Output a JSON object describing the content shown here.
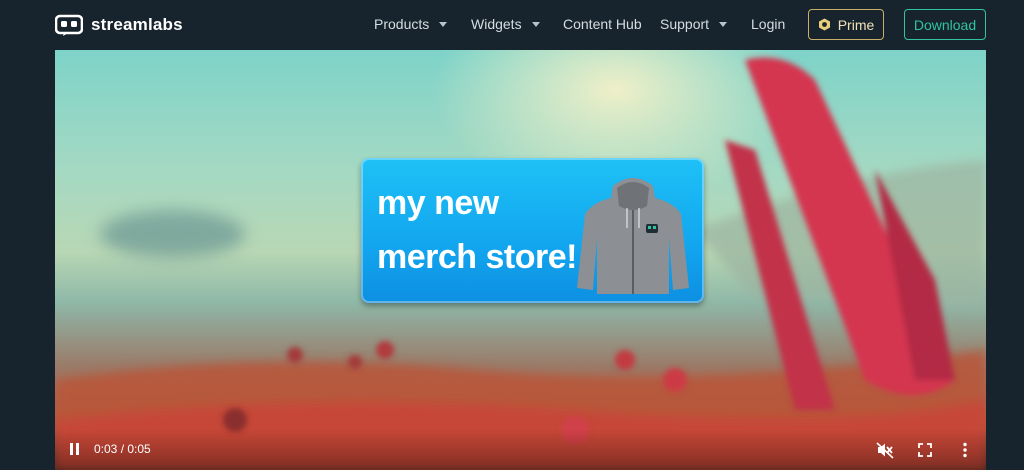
{
  "brand": {
    "name": "streamlabs",
    "icon": "streamlabs-logo-icon"
  },
  "nav": {
    "items": [
      {
        "label": "Products",
        "has_dropdown": true
      },
      {
        "label": "Widgets",
        "has_dropdown": true
      },
      {
        "label": "Content Hub",
        "has_dropdown": false
      },
      {
        "label": "Support",
        "has_dropdown": true
      },
      {
        "label": "Login",
        "has_dropdown": false
      }
    ],
    "prime_label": "Prime",
    "download_label": "Download"
  },
  "video": {
    "overlay_line1": "my new",
    "overlay_line2": "merch store!",
    "time_display": "0:03 / 0:05",
    "state": "playing",
    "muted": true
  },
  "colors": {
    "header_bg": "#17242d",
    "accent_teal": "#31c3a2",
    "prime_gold": "#c8b06a",
    "card_blue": "#12a6ef"
  }
}
